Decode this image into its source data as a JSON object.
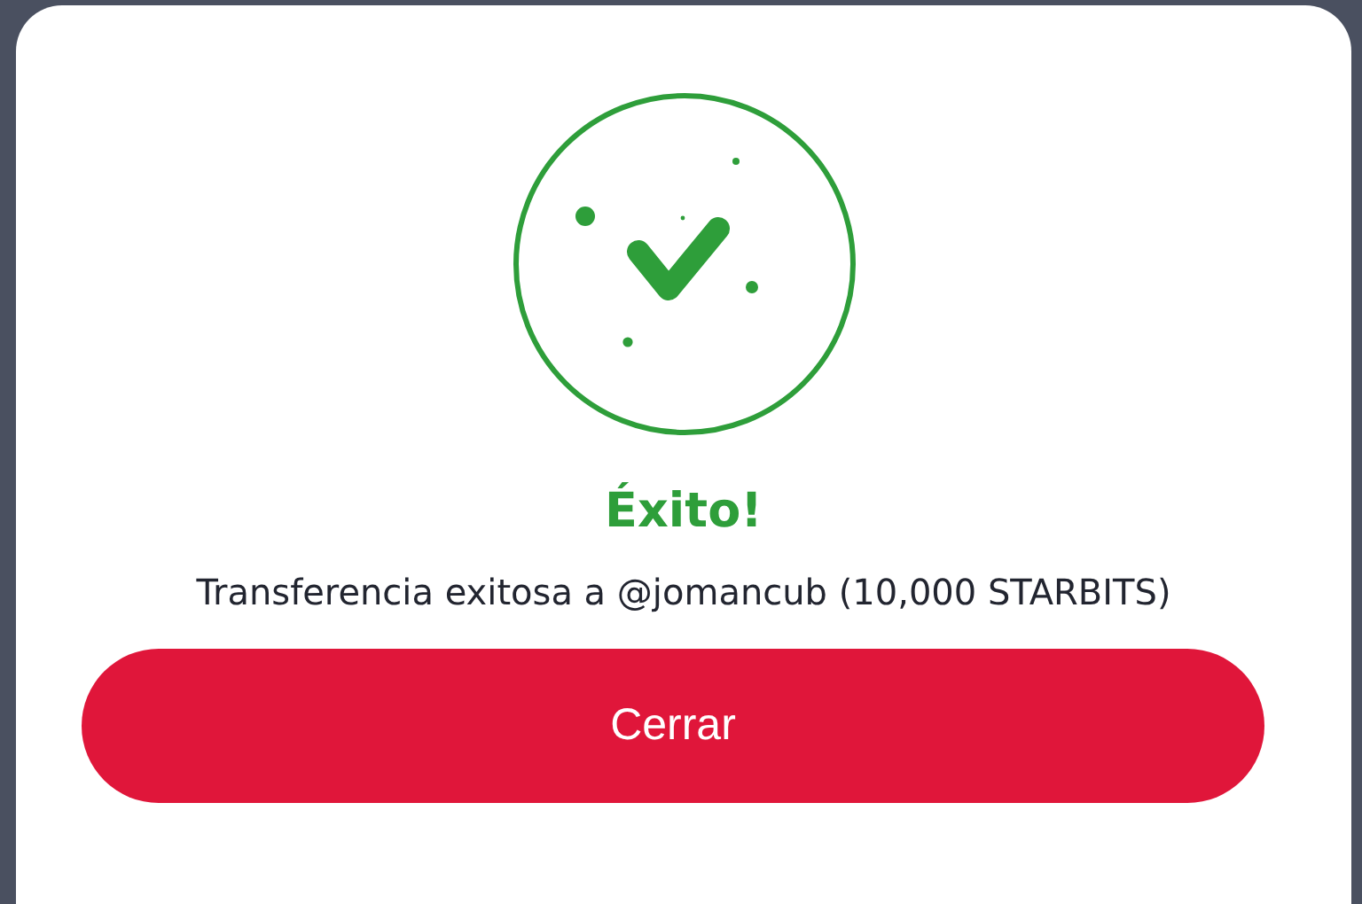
{
  "dialog": {
    "kind": "success",
    "title": "Éxito!",
    "message": "Transferencia exitosa a @jomancub (10,000 STARBITS)",
    "buttons": [
      "Cerrar"
    ]
  }
}
